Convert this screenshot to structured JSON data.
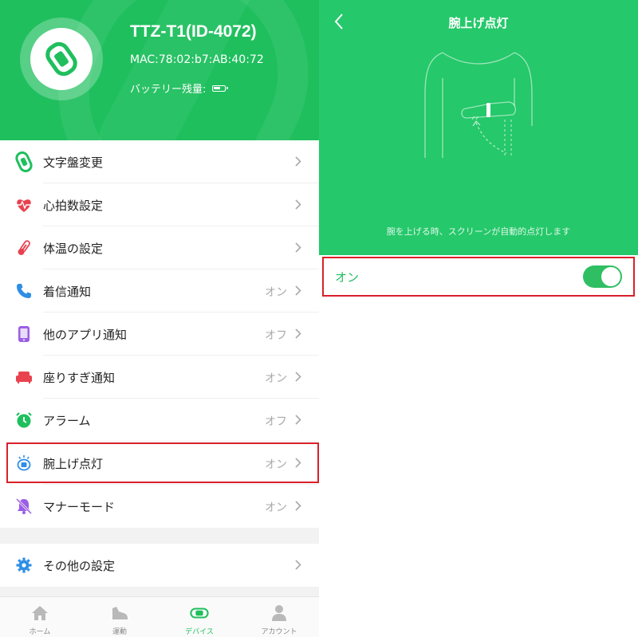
{
  "device": {
    "name": "TTZ-T1(ID-4072)",
    "mac": "MAC:78:02:b7:AB:40:72",
    "battery_label": "バッテリー残量:",
    "battery_level": 0.7,
    "icon": "band-icon"
  },
  "menu": {
    "items": [
      {
        "label": "文字盤変更",
        "status": "",
        "icon": "watch-face-icon"
      },
      {
        "label": "心拍数設定",
        "status": "",
        "icon": "heart-rate-icon"
      },
      {
        "label": "体温の設定",
        "status": "",
        "icon": "thermometer-icon"
      },
      {
        "label": "着信通知",
        "status": "オン",
        "icon": "phone-icon"
      },
      {
        "label": "他のアプリ通知",
        "status": "オフ",
        "icon": "smartphone-icon"
      },
      {
        "label": "座りすぎ通知",
        "status": "オン",
        "icon": "sofa-icon"
      },
      {
        "label": "アラーム",
        "status": "オフ",
        "icon": "alarm-clock-icon"
      },
      {
        "label": "腕上げ点灯",
        "status": "オン",
        "icon": "raise-wrist-icon"
      },
      {
        "label": "マナーモード",
        "status": "オン",
        "icon": "mute-bell-icon"
      }
    ],
    "other_settings": {
      "label": "その他の設定",
      "icon": "gear-icon"
    }
  },
  "tabs": [
    {
      "label": "ホーム",
      "icon": "home-icon",
      "active": false
    },
    {
      "label": "運動",
      "icon": "shoe-icon",
      "active": false
    },
    {
      "label": "デバイス",
      "icon": "device-icon",
      "active": true
    },
    {
      "label": "アカウント",
      "icon": "person-icon",
      "active": false
    }
  ],
  "detail": {
    "title": "腕上げ点灯",
    "caption": "腕を上げる時、スクリーンが自動的点灯します",
    "toggle_label": "オン",
    "toggle_on": true
  },
  "colors": {
    "header_green": "#1fbf5e",
    "detail_green": "#25c86a",
    "highlight_red": "#d9202a",
    "status_gray": "#a9a9a9"
  }
}
